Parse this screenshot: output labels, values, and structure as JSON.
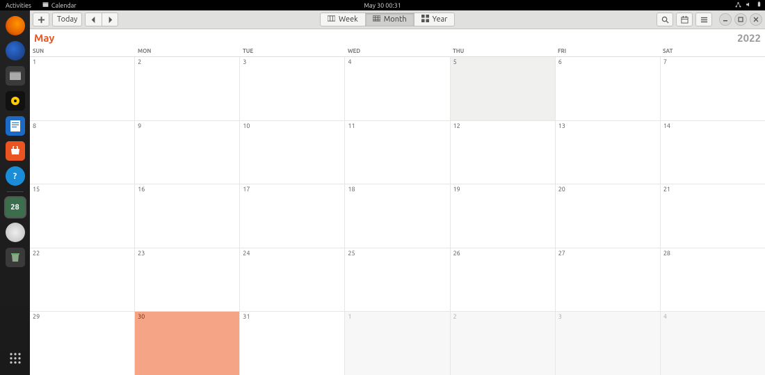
{
  "topbar": {
    "activities": "Activities",
    "app_label": "Calendar",
    "clock": "May 30  00:31"
  },
  "dock": {
    "icons": [
      {
        "name": "firefox",
        "bg": "radial-gradient(circle at 60% 40%, #ff9500, #e66000 60%, #7f2a00)",
        "glyph": ""
      },
      {
        "name": "thunderbird",
        "bg": "radial-gradient(circle at 40% 40%, #2e6bd6, #14356d)",
        "glyph": ""
      },
      {
        "name": "files",
        "bg": "#3a3a3a",
        "glyph": ""
      },
      {
        "name": "rhythmbox",
        "bg": "#111",
        "glyph": ""
      },
      {
        "name": "writer",
        "bg": "#1b6ac6",
        "glyph": ""
      },
      {
        "name": "software",
        "bg": "#e95420",
        "glyph": ""
      },
      {
        "name": "help",
        "bg": "#1a8cd8",
        "glyph": "?"
      }
    ],
    "pinned": [
      {
        "name": "calendar",
        "bg": "#3b6e4c",
        "glyph": "28",
        "running": true
      },
      {
        "name": "disk",
        "bg": "#ccc",
        "glyph": ""
      },
      {
        "name": "trash",
        "bg": "#3a3a3a",
        "glyph": ""
      }
    ]
  },
  "toolbar": {
    "today": "Today",
    "views": {
      "week": "Week",
      "month": "Month",
      "year": "Year"
    },
    "active_view": "month"
  },
  "calendar": {
    "month": "May",
    "year": "2022",
    "weekdays": [
      "SUN",
      "MON",
      "TUE",
      "WED",
      "THU",
      "FRI",
      "SAT"
    ],
    "weeks": [
      [
        {
          "n": "1",
          "cls": ""
        },
        {
          "n": "2",
          "cls": ""
        },
        {
          "n": "3",
          "cls": ""
        },
        {
          "n": "4",
          "cls": ""
        },
        {
          "n": "5",
          "cls": "off"
        },
        {
          "n": "6",
          "cls": ""
        },
        {
          "n": "7",
          "cls": ""
        }
      ],
      [
        {
          "n": "8",
          "cls": ""
        },
        {
          "n": "9",
          "cls": ""
        },
        {
          "n": "10",
          "cls": ""
        },
        {
          "n": "11",
          "cls": ""
        },
        {
          "n": "12",
          "cls": ""
        },
        {
          "n": "13",
          "cls": ""
        },
        {
          "n": "14",
          "cls": ""
        }
      ],
      [
        {
          "n": "15",
          "cls": ""
        },
        {
          "n": "16",
          "cls": ""
        },
        {
          "n": "17",
          "cls": ""
        },
        {
          "n": "18",
          "cls": ""
        },
        {
          "n": "19",
          "cls": ""
        },
        {
          "n": "20",
          "cls": ""
        },
        {
          "n": "21",
          "cls": ""
        }
      ],
      [
        {
          "n": "22",
          "cls": ""
        },
        {
          "n": "23",
          "cls": ""
        },
        {
          "n": "24",
          "cls": ""
        },
        {
          "n": "25",
          "cls": ""
        },
        {
          "n": "26",
          "cls": ""
        },
        {
          "n": "27",
          "cls": ""
        },
        {
          "n": "28",
          "cls": ""
        }
      ],
      [
        {
          "n": "29",
          "cls": ""
        },
        {
          "n": "30",
          "cls": "today"
        },
        {
          "n": "31",
          "cls": ""
        },
        {
          "n": "1",
          "cls": "other-month"
        },
        {
          "n": "2",
          "cls": "other-month"
        },
        {
          "n": "3",
          "cls": "other-month"
        },
        {
          "n": "4",
          "cls": "other-month"
        }
      ]
    ]
  }
}
